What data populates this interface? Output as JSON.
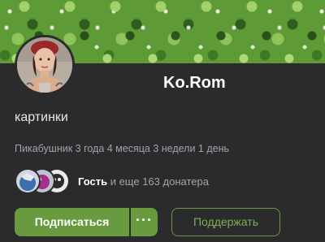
{
  "profile": {
    "username": "Ko.Rom",
    "description": "картинки",
    "tenure": "Пикабушник 3 года 4 месяца 3 недели 1 день"
  },
  "donators": {
    "first_name": "Гость",
    "rest_text": " и еще 163 донатера"
  },
  "actions": {
    "subscribe_label": "Подписаться",
    "more_label": "···",
    "support_label": "Поддержать"
  },
  "colors": {
    "background": "#2b2b2e",
    "accent": "#6a9a40",
    "muted_text": "#a3a3a8"
  }
}
